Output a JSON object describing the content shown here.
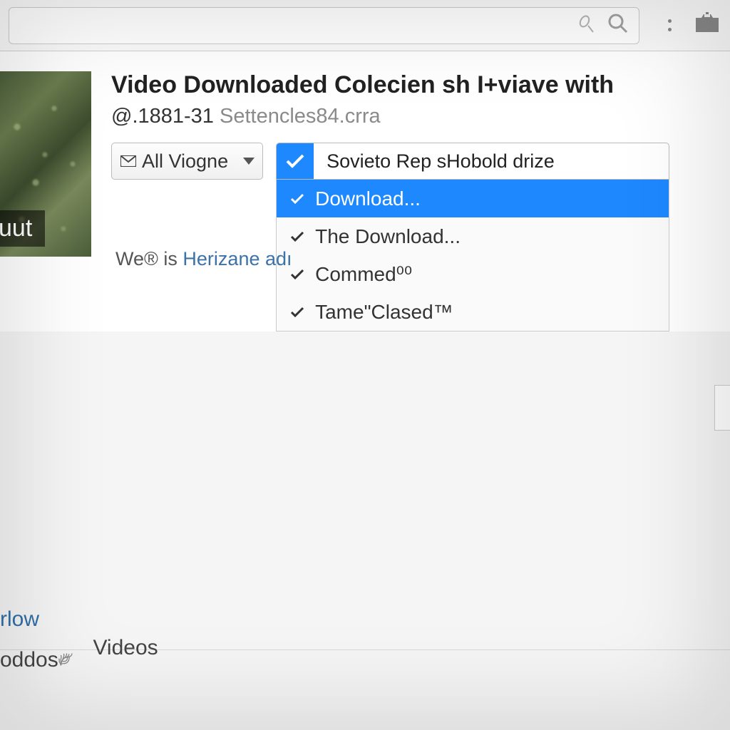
{
  "toolbar": {
    "icons": {
      "mic": "mic-icon",
      "search": "search-icon",
      "more": "more-icon",
      "camera": "camera-icon"
    }
  },
  "video": {
    "thumb_label": "uut",
    "title": "Video Downloaded Colecien sh I+viave with",
    "sub_prefix": "@.1881-31",
    "sub_grey": " Settencles84.crra",
    "dropdown_label": "All Viogne",
    "desc_prefix": "We® is ",
    "desc_link": "Herizane adı"
  },
  "menu": {
    "header_text": "Sovieto Rep sHobold drize",
    "items": [
      {
        "label": "Download...",
        "selected": true
      },
      {
        "label": "The Download...",
        "selected": false
      },
      {
        "label": "Commed⁰⁰",
        "selected": false
      },
      {
        "label": "Tame\"Clased™",
        "selected": false
      }
    ]
  },
  "footer": {
    "link": "rlow",
    "tab1": "oddos",
    "tab2": "Videos"
  }
}
